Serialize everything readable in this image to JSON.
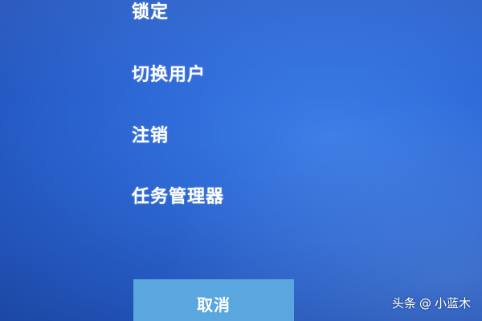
{
  "menu": {
    "items": [
      {
        "label": "锁定"
      },
      {
        "label": "切换用户"
      },
      {
        "label": "注销"
      },
      {
        "label": "任务管理器"
      }
    ]
  },
  "cancel_label": "取消",
  "watermark": {
    "source": "头条",
    "separator": "@",
    "author": "小蓝木"
  },
  "colors": {
    "background": "#2e6ad8",
    "button": "#5aa6df",
    "text": "#ffffff"
  }
}
